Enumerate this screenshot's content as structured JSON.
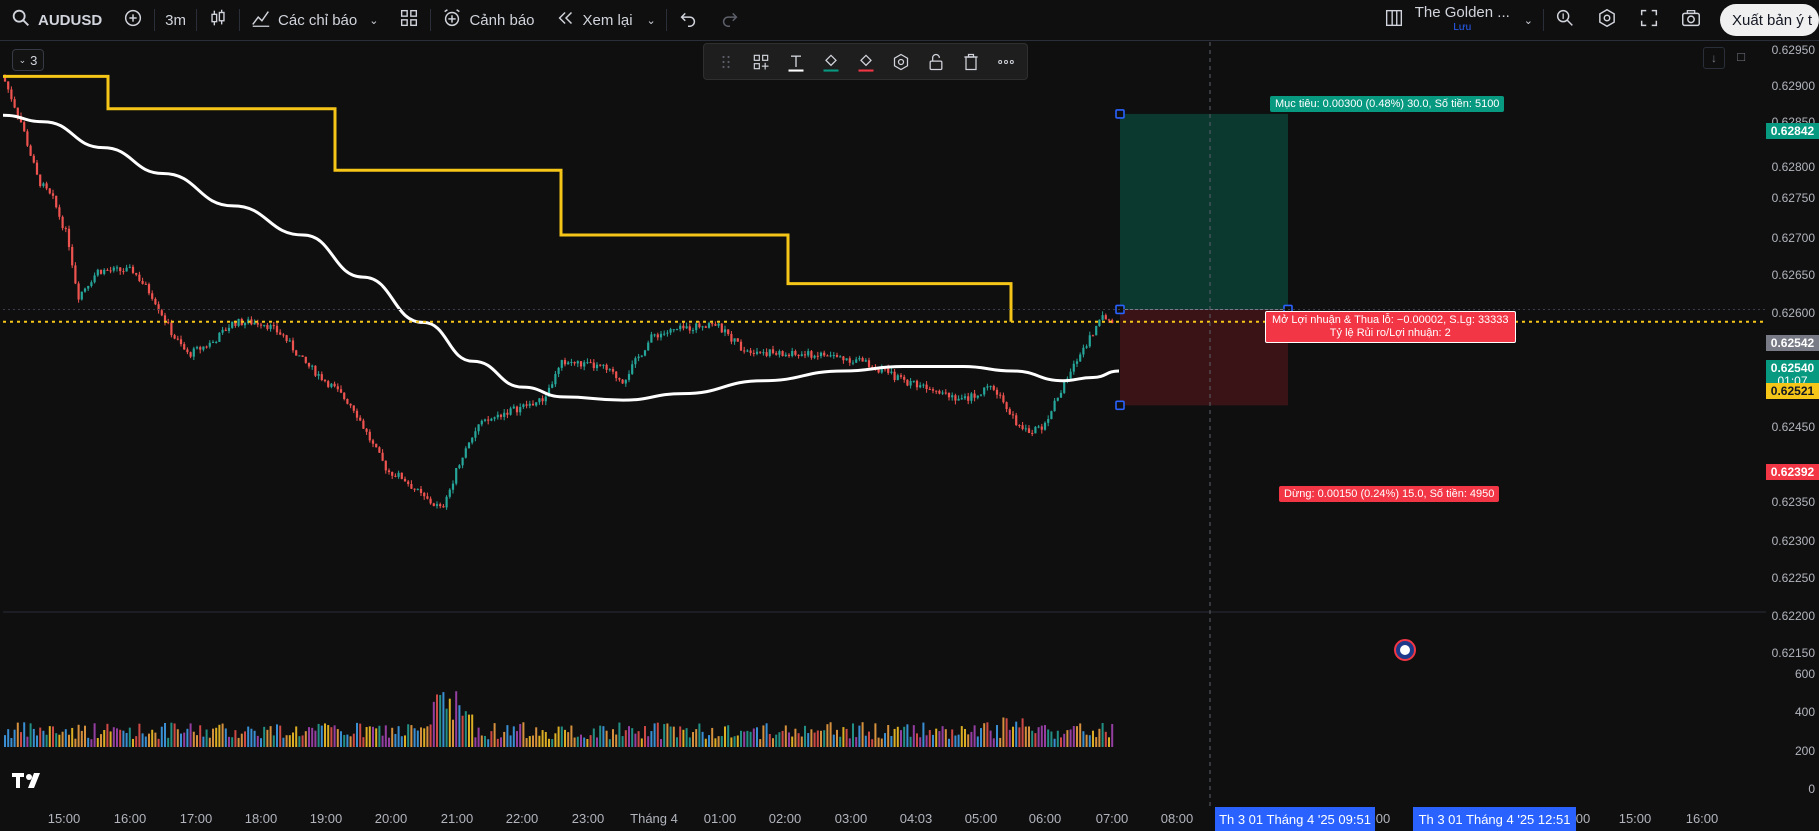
{
  "toolbar": {
    "symbol": "AUDUSD",
    "interval": "3m",
    "indicators_label": "Các chỉ báo",
    "alert_label": "Cảnh báo",
    "replay_label": "Xem lại",
    "layout_name": "The Golden ...",
    "layout_status": "Lưu",
    "publish_label": "Xuất bản ý t"
  },
  "legend": {
    "toggle_label": "3"
  },
  "price_scale": {
    "labels": [
      "0.62950",
      "0.62900",
      "0.62850",
      "0.62800",
      "0.62750",
      "0.62700",
      "0.62650",
      "0.62600",
      "0.62500",
      "0.62450",
      "0.62400",
      "0.62350",
      "0.62300",
      "0.62250",
      "0.62200",
      "0.62150"
    ],
    "tags": {
      "target": "0.62842",
      "entry_top": "0.62542",
      "last": "0.62540",
      "countdown": "01:07",
      "bid": "0.62521",
      "stop": "0.62392"
    },
    "volume_labels": [
      "600",
      "400",
      "200",
      "0"
    ]
  },
  "time_axis": {
    "labels": [
      "15:00",
      "16:00",
      "17:00",
      "18:00",
      "19:00",
      "20:00",
      "21:00",
      "22:00",
      "23:00",
      "Tháng 4",
      "01:00",
      "02:00",
      "03:00",
      "04:03",
      "05:00",
      "06:00",
      "07:00",
      "08:00",
      "00",
      "00",
      "15:00",
      "16:00"
    ],
    "cursor_tag_1": "Th 3 01 Tháng 4 '25   09:51",
    "cursor_tag_2": "Th 3 01 Tháng 4 '25   12:51"
  },
  "position_tool": {
    "target_label": "Mục tiêu: 0.00300 (0.48%) 30.0, Số tiền: 5100",
    "pl_line1": "Mở Lợi nhuận & Thua lỗ: −0.00002, S.Lg: 33333",
    "pl_line2": "Tỷ lệ Rủi ro/Lợi nhuận: 2",
    "stop_label": "Dừng: 0.00150 (0.24%) 15.0, Số tiền: 4950"
  },
  "colors": {
    "up": "#26a69a",
    "down": "#ef5350",
    "step_line": "#f5c518",
    "ma_line": "#ffffff",
    "target_zone": "#0c3b32",
    "stop_zone": "#3d1418",
    "accent": "#2962ff"
  },
  "icons": {
    "search": "search-icon",
    "add_symbol": "plus-circle-icon",
    "candles": "candles-icon",
    "indicators": "indicators-icon",
    "templates": "grid-icon",
    "alert": "alarm-icon",
    "replay": "rewind-icon",
    "undo": "undo-icon",
    "redo": "redo-icon"
  }
}
